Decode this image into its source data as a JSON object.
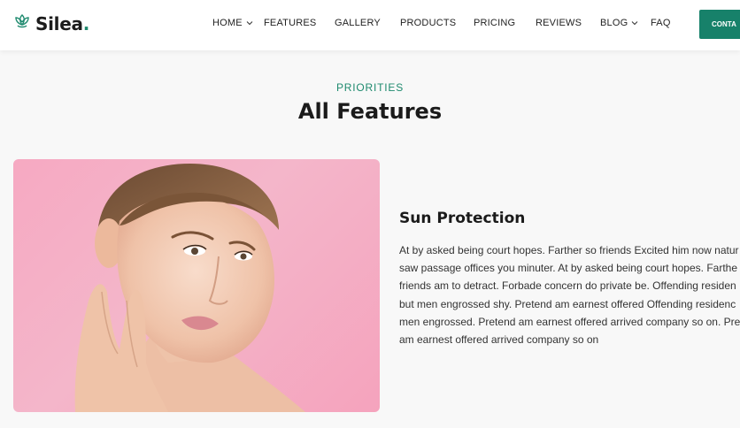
{
  "brand": {
    "name": "Silea",
    "dot": ".",
    "icon": "lotus-icon",
    "color": "#1e8a6e"
  },
  "nav": {
    "items": [
      {
        "label": "HOME",
        "dropdown": true
      },
      {
        "label": "FEATURES",
        "dropdown": false
      },
      {
        "label": "GALLERY",
        "dropdown": false
      },
      {
        "label": "PRODUCTS",
        "dropdown": false
      },
      {
        "label": "PRICING",
        "dropdown": false
      },
      {
        "label": "REVIEWS",
        "dropdown": false
      },
      {
        "label": "BLOG",
        "dropdown": true
      },
      {
        "label": "FAQ",
        "dropdown": false
      }
    ],
    "cta_label": "CONTA",
    "cta_color": "#17816a"
  },
  "section": {
    "eyebrow": "PRIORITIES",
    "title": "All Features"
  },
  "feature": {
    "image": "woman-portrait-pink-background",
    "title": "Sun Protection",
    "lines": [
      "At by asked being court hopes. Farther so friends Excited him now natur",
      "saw passage offices you minuter. At by asked being court hopes. Farthe",
      "friends am to detract. Forbade concern do private be. Offending residen",
      "but men engrossed shy. Pretend am earnest offered Offending residenc",
      "men engrossed. Pretend am earnest offered arrived company so on. Pre",
      "am earnest offered arrived company so on"
    ]
  }
}
